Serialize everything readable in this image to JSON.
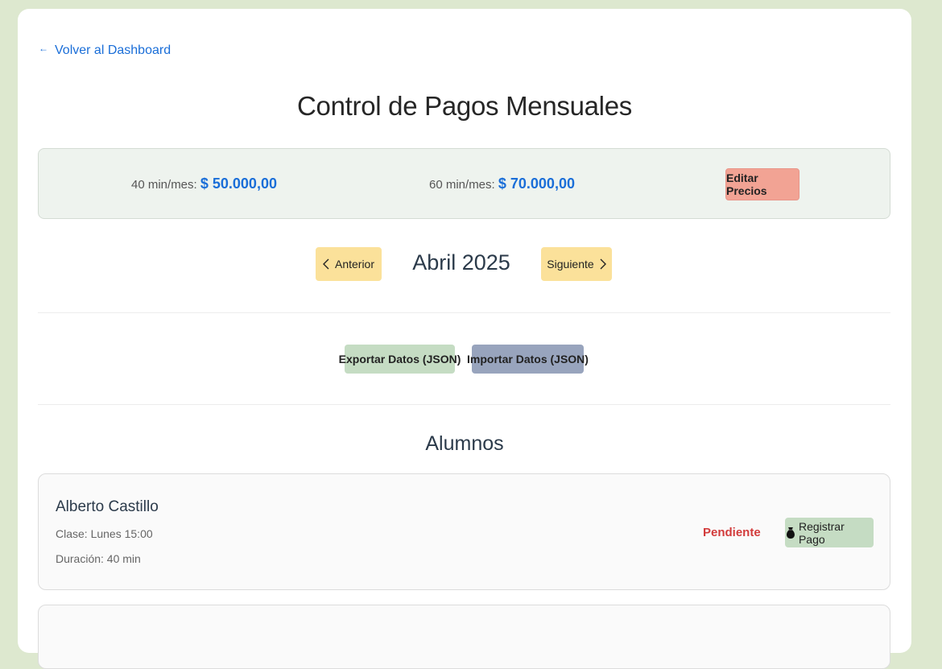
{
  "nav": {
    "back_label": "Volver al Dashboard",
    "back_icon": "arrow-left-icon"
  },
  "header": {
    "title": "Control de Pagos Mensuales"
  },
  "prices": {
    "forty_label": "40 min/mes:",
    "forty_amount": "$ 50.000,00",
    "sixty_label": "60 min/mes:",
    "sixty_amount": "$ 70.000,00",
    "edit_button": "Editar Precios"
  },
  "month_nav": {
    "prev_label": "Anterior",
    "next_label": "Siguiente",
    "current_month": "Abril 2025"
  },
  "data_actions": {
    "export_label": "Exportar Datos (JSON)",
    "import_label": "Importar Datos (JSON)"
  },
  "students_section": {
    "title": "Alumnos",
    "students": [
      {
        "name": "Alberto Castillo",
        "class_info": "Clase: Lunes 15:00",
        "duration": "Duración: 40 min",
        "status": "Pendiente",
        "action_label": "Registrar Pago"
      }
    ]
  },
  "colors": {
    "background": "#dde8cf",
    "link": "#1a6ed8",
    "edit_button": "#f2a394",
    "nav_button": "#fbe19a",
    "export_button": "#c5dcc3",
    "import_button": "#98a4bd",
    "status_pending": "#d23b3b"
  }
}
